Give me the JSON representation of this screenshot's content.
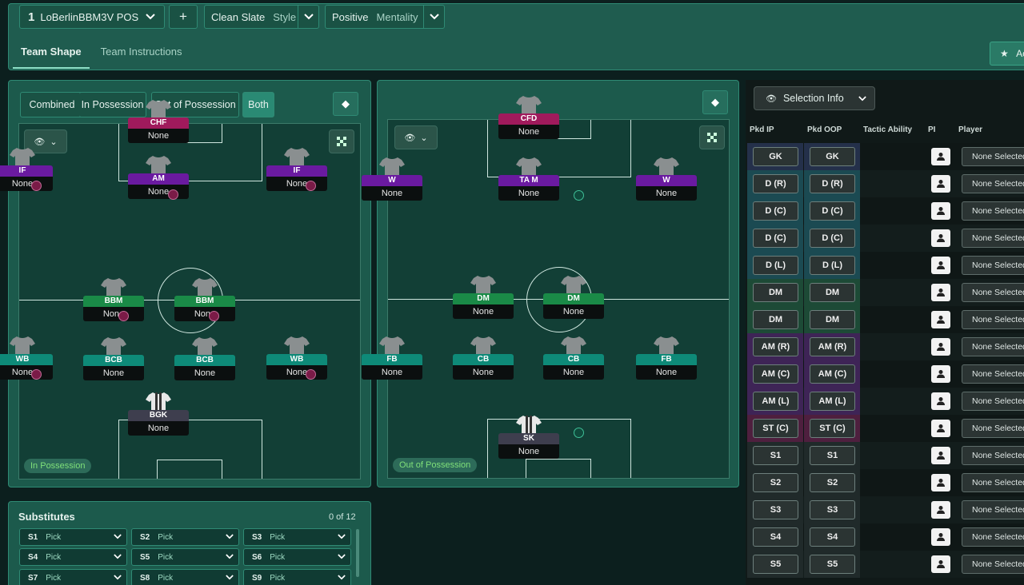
{
  "topbar": {
    "tactic_number": "1",
    "tactic_name": "LoBerlinBBM3V POS",
    "add_label": "+",
    "style_value": "Clean Slate",
    "style_label": "Style",
    "mentality_value": "Positive",
    "mentality_label": "Mentality",
    "tabs": [
      "Team Shape",
      "Team Instructions"
    ],
    "right_button_partial": "Ac"
  },
  "view_toggle": [
    "Combined",
    "In Possession",
    "Out of Possession",
    "Both"
  ],
  "pitch_ip": {
    "label": "In Possession",
    "positions": [
      {
        "role": "CHF",
        "player": "None",
        "color": "#a01a5c"
      },
      {
        "role": "IF",
        "player": "None",
        "color": "#6a1aa0"
      },
      {
        "role": "AM",
        "player": "None",
        "color": "#6a1aa0"
      },
      {
        "role": "IF",
        "player": "None",
        "color": "#6a1aa0"
      },
      {
        "role": "BBM",
        "player": "None",
        "color": "#1a8a47"
      },
      {
        "role": "BBM",
        "player": "None",
        "color": "#1a8a47"
      },
      {
        "role": "WB",
        "player": "None",
        "color": "#0e8a78"
      },
      {
        "role": "BCB",
        "player": "None",
        "color": "#0e8a78"
      },
      {
        "role": "BCB",
        "player": "None",
        "color": "#0e8a78"
      },
      {
        "role": "WB",
        "player": "None",
        "color": "#0e8a78"
      },
      {
        "role": "BGK",
        "player": "None",
        "color": "#3e3e4e"
      }
    ]
  },
  "pitch_oop": {
    "label": "Out of Possession",
    "positions": [
      {
        "role": "CFD",
        "player": "None",
        "color": "#a01a5c"
      },
      {
        "role": "W",
        "player": "None",
        "color": "#6a1aa0"
      },
      {
        "role": "TA M",
        "player": "None",
        "color": "#6a1aa0"
      },
      {
        "role": "W",
        "player": "None",
        "color": "#6a1aa0"
      },
      {
        "role": "DM",
        "player": "None",
        "color": "#1a8a47"
      },
      {
        "role": "DM",
        "player": "None",
        "color": "#1a8a47"
      },
      {
        "role": "FB",
        "player": "None",
        "color": "#0e8a78"
      },
      {
        "role": "CB",
        "player": "None",
        "color": "#0e8a78"
      },
      {
        "role": "CB",
        "player": "None",
        "color": "#0e8a78"
      },
      {
        "role": "FB",
        "player": "None",
        "color": "#0e8a78"
      },
      {
        "role": "SK",
        "player": "None",
        "color": "#3e3e4e"
      }
    ]
  },
  "substitutes": {
    "title": "Substitutes",
    "count": "0 of 12",
    "slots": [
      {
        "slot": "S1",
        "value": "Pick"
      },
      {
        "slot": "S2",
        "value": "Pick"
      },
      {
        "slot": "S3",
        "value": "Pick"
      },
      {
        "slot": "S4",
        "value": "Pick"
      },
      {
        "slot": "S5",
        "value": "Pick"
      },
      {
        "slot": "S6",
        "value": "Pick"
      },
      {
        "slot": "S7",
        "value": "Pick"
      },
      {
        "slot": "S8",
        "value": "Pick"
      },
      {
        "slot": "S9",
        "value": "Pick"
      }
    ]
  },
  "selection": {
    "dropdown_label": "Selection Info",
    "headers": [
      "Pkd IP",
      "Pkd OOP",
      "Tactic Ability",
      "PI",
      "Player"
    ],
    "rows": [
      {
        "ip": "GK",
        "oop": "GK",
        "player": "None Selected",
        "tint": "#24304a"
      },
      {
        "ip": "D (R)",
        "oop": "D (R)",
        "player": "None Selected",
        "tint": "#1b4a52"
      },
      {
        "ip": "D (C)",
        "oop": "D (C)",
        "player": "None Selected",
        "tint": "#1b4a52"
      },
      {
        "ip": "D (C)",
        "oop": "D (C)",
        "player": "None Selected",
        "tint": "#1b4a52"
      },
      {
        "ip": "D (L)",
        "oop": "D (L)",
        "player": "None Selected",
        "tint": "#1b4a52"
      },
      {
        "ip": "DM",
        "oop": "DM",
        "player": "None Selected",
        "tint": "#1d4a36"
      },
      {
        "ip": "DM",
        "oop": "DM",
        "player": "None Selected",
        "tint": "#1d4a36"
      },
      {
        "ip": "AM (R)",
        "oop": "AM (R)",
        "player": "None Selected",
        "tint": "#3e2456"
      },
      {
        "ip": "AM (C)",
        "oop": "AM (C)",
        "player": "None Selected",
        "tint": "#3e2456"
      },
      {
        "ip": "AM (L)",
        "oop": "AM (L)",
        "player": "None Selected",
        "tint": "#3e2456"
      },
      {
        "ip": "ST (C)",
        "oop": "ST (C)",
        "player": "None Selected",
        "tint": "#4e1f3e"
      },
      {
        "ip": "S1",
        "oop": "S1",
        "player": "None Selected",
        "tint": "#202a2a"
      },
      {
        "ip": "S2",
        "oop": "S2",
        "player": "None Selected",
        "tint": "#202a2a"
      },
      {
        "ip": "S3",
        "oop": "S3",
        "player": "None Selected",
        "tint": "#202a2a"
      },
      {
        "ip": "S4",
        "oop": "S4",
        "player": "None Selected",
        "tint": "#202a2a"
      },
      {
        "ip": "S5",
        "oop": "S5",
        "player": "None Selected",
        "tint": "#202a2a"
      }
    ]
  }
}
